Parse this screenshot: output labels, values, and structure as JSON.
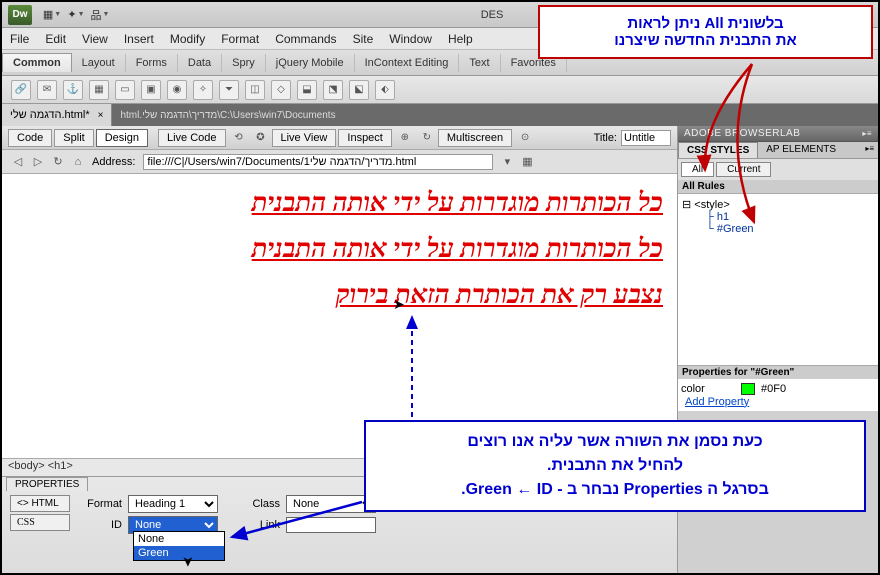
{
  "app": {
    "logo": "Dw",
    "title_fragment": "DES"
  },
  "menubar": [
    "File",
    "Edit",
    "View",
    "Insert",
    "Modify",
    "Format",
    "Commands",
    "Site",
    "Window",
    "Help"
  ],
  "insert_tabs": [
    "Common",
    "Layout",
    "Forms",
    "Data",
    "Spry",
    "jQuery Mobile",
    "InContext Editing",
    "Text",
    "Favorites"
  ],
  "doc_tab": {
    "name": "הדגמה שלי.html*",
    "close": "×"
  },
  "doc_path": "C:\\Users\\win7\\Documents\\מדריך\\הדגמה שלי.html",
  "doc_toolbar": {
    "code": "Code",
    "split": "Split",
    "design": "Design",
    "live_code": "Live Code",
    "live_view": "Live View",
    "inspect": "Inspect",
    "multiscreen": "Multiscreen",
    "title_label": "Title:",
    "title_value": "Untitle"
  },
  "address": {
    "label": "Address:",
    "value": "file:///C|/Users/win7/Documents/1מדריך/הדגמה שלי.html"
  },
  "canvas": {
    "h1": "כל הכותרות מוגדרות על ידי אותה התבנית",
    "h2": "כל הכותרות מוגדרות על ידי אותה התבנית",
    "h3": "נצבע רק את הכותרת הזאת בירוק"
  },
  "tag_selector": "<body> <h1>",
  "properties": {
    "panel": "PROPERTIES",
    "html_btn": "<> HTML",
    "css_btn": "CSS",
    "format_label": "Format",
    "format_value": "Heading 1",
    "id_label": "ID",
    "id_value": "None",
    "class_label": "Class",
    "class_value": "None",
    "link_label": "Link",
    "id_options": [
      "None",
      "Green"
    ]
  },
  "right": {
    "browserlab": "ADOBE BROWSERLAB",
    "css_styles": "CSS STYLES",
    "ap_elements": "AP ELEMENTS",
    "all": "All",
    "current": "Current",
    "all_rules": "All Rules",
    "tree_root": "⊟ <style>",
    "tree_h1": "h1",
    "tree_green": "#Green",
    "props_for": "Properties for \"#Green\"",
    "prop_color_label": "color",
    "prop_color_value": "#0F0",
    "add_property": "Add Property"
  },
  "callouts": {
    "red": "בלשונית All ניתן לראות\nאת התבנית החדשה שיצרנו",
    "blue": "כעת נסמן את השורה אשר עליה אנו רוצים\nלהחיל את התבנית.\nבסרגל ה Properties נבחר ב - ID ←‏ Green."
  }
}
